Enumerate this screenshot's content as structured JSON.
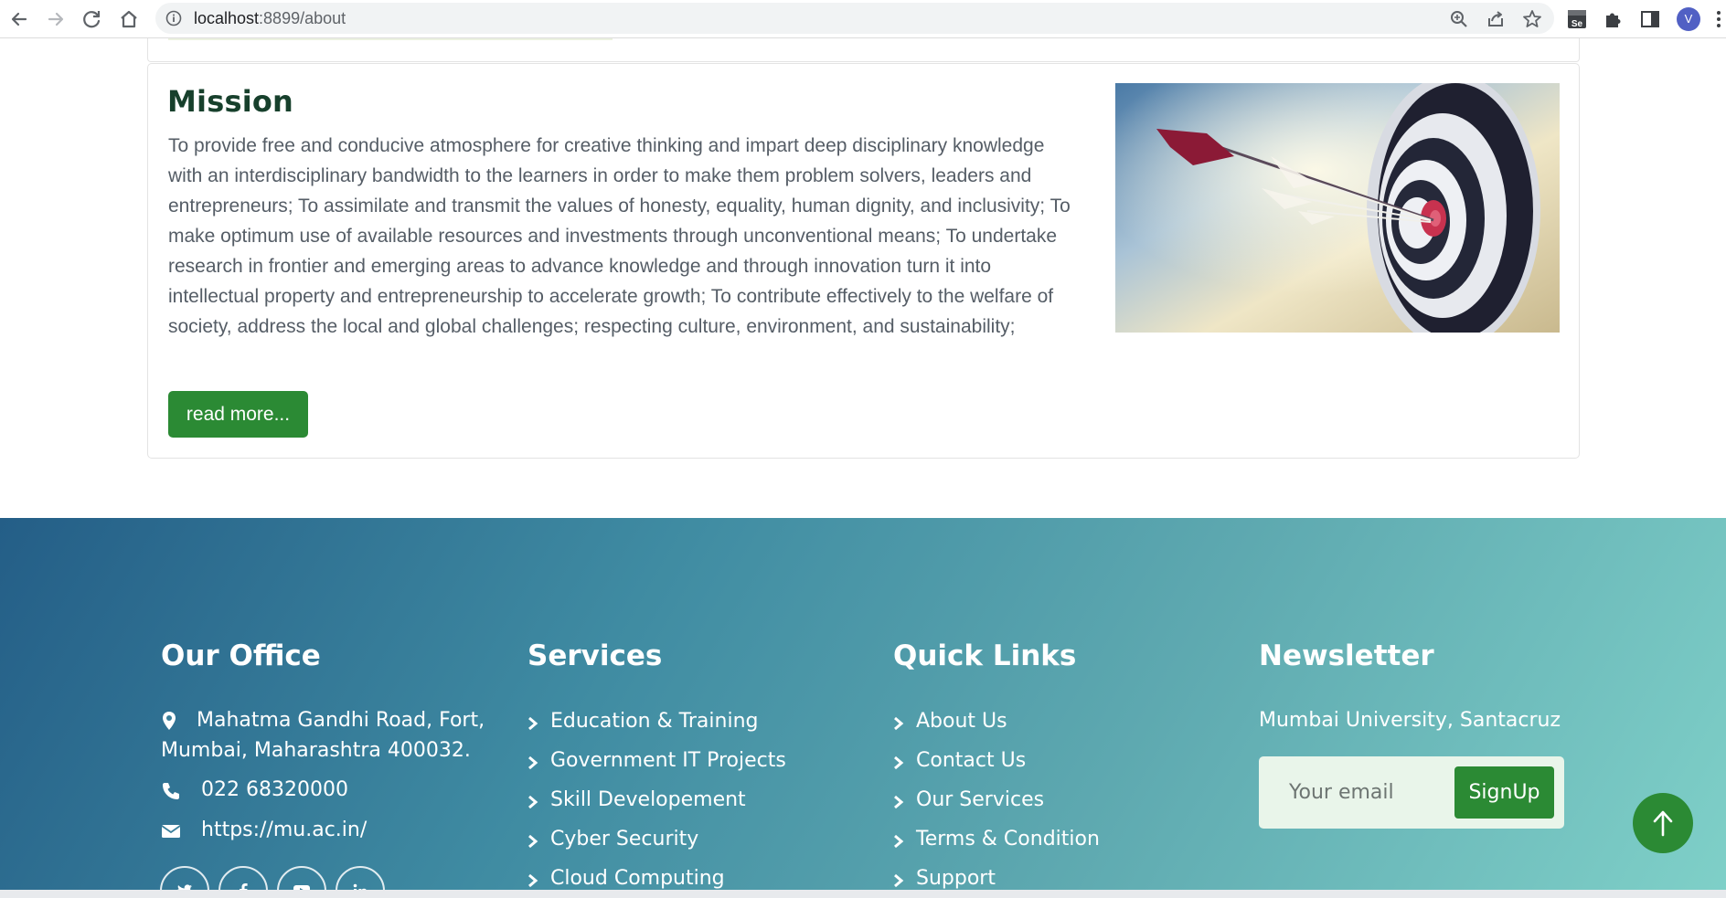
{
  "browser": {
    "url_host": "localhost",
    "url_path": ":8899/about",
    "profile_initial": "V"
  },
  "mission": {
    "title": "Mission",
    "text": "To provide free and conducive atmosphere for creative thinking and impart deep disciplinary knowledge with an interdisciplinary bandwidth to the learners in order to make them problem solvers, leaders and entrepreneurs; To assimilate and transmit the values of honesty, equality, human dignity, and inclusivity; To make optimum use of available resources and investments through unconventional means; To undertake research in frontier and emerging areas to advance knowledge and through innovation turn it into intellectual property and entrepreneurship to accelerate growth; To contribute effectively to the welfare of society, address the local and global challenges; respecting culture, environment, and sustainability;",
    "read_more_label": "read more..."
  },
  "footer": {
    "office": {
      "heading": "Our Office",
      "address_line1": "Mahatma Gandhi Road, Fort,",
      "address_line2": "Mumbai, Maharashtra 400032.",
      "phone": "022 68320000",
      "website": "https://mu.ac.in/"
    },
    "services": {
      "heading": "Services",
      "items": [
        {
          "label": "Education & Training"
        },
        {
          "label": "Government IT Projects"
        },
        {
          "label": "Skill Developement"
        },
        {
          "label": "Cyber Security"
        },
        {
          "label": "Cloud Computing"
        }
      ]
    },
    "quick_links": {
      "heading": "Quick Links",
      "items": [
        {
          "label": "About Us"
        },
        {
          "label": "Contact Us"
        },
        {
          "label": "Our Services"
        },
        {
          "label": "Terms & Condition"
        },
        {
          "label": "Support"
        }
      ]
    },
    "newsletter": {
      "heading": "Newsletter",
      "location": "Mumbai University, Santacruz",
      "email_placeholder": "Your email",
      "signup_label": "SignUp"
    }
  },
  "colors": {
    "accent_green": "#2b8a34",
    "mission_title": "#17402c",
    "body_text": "#555d66"
  }
}
